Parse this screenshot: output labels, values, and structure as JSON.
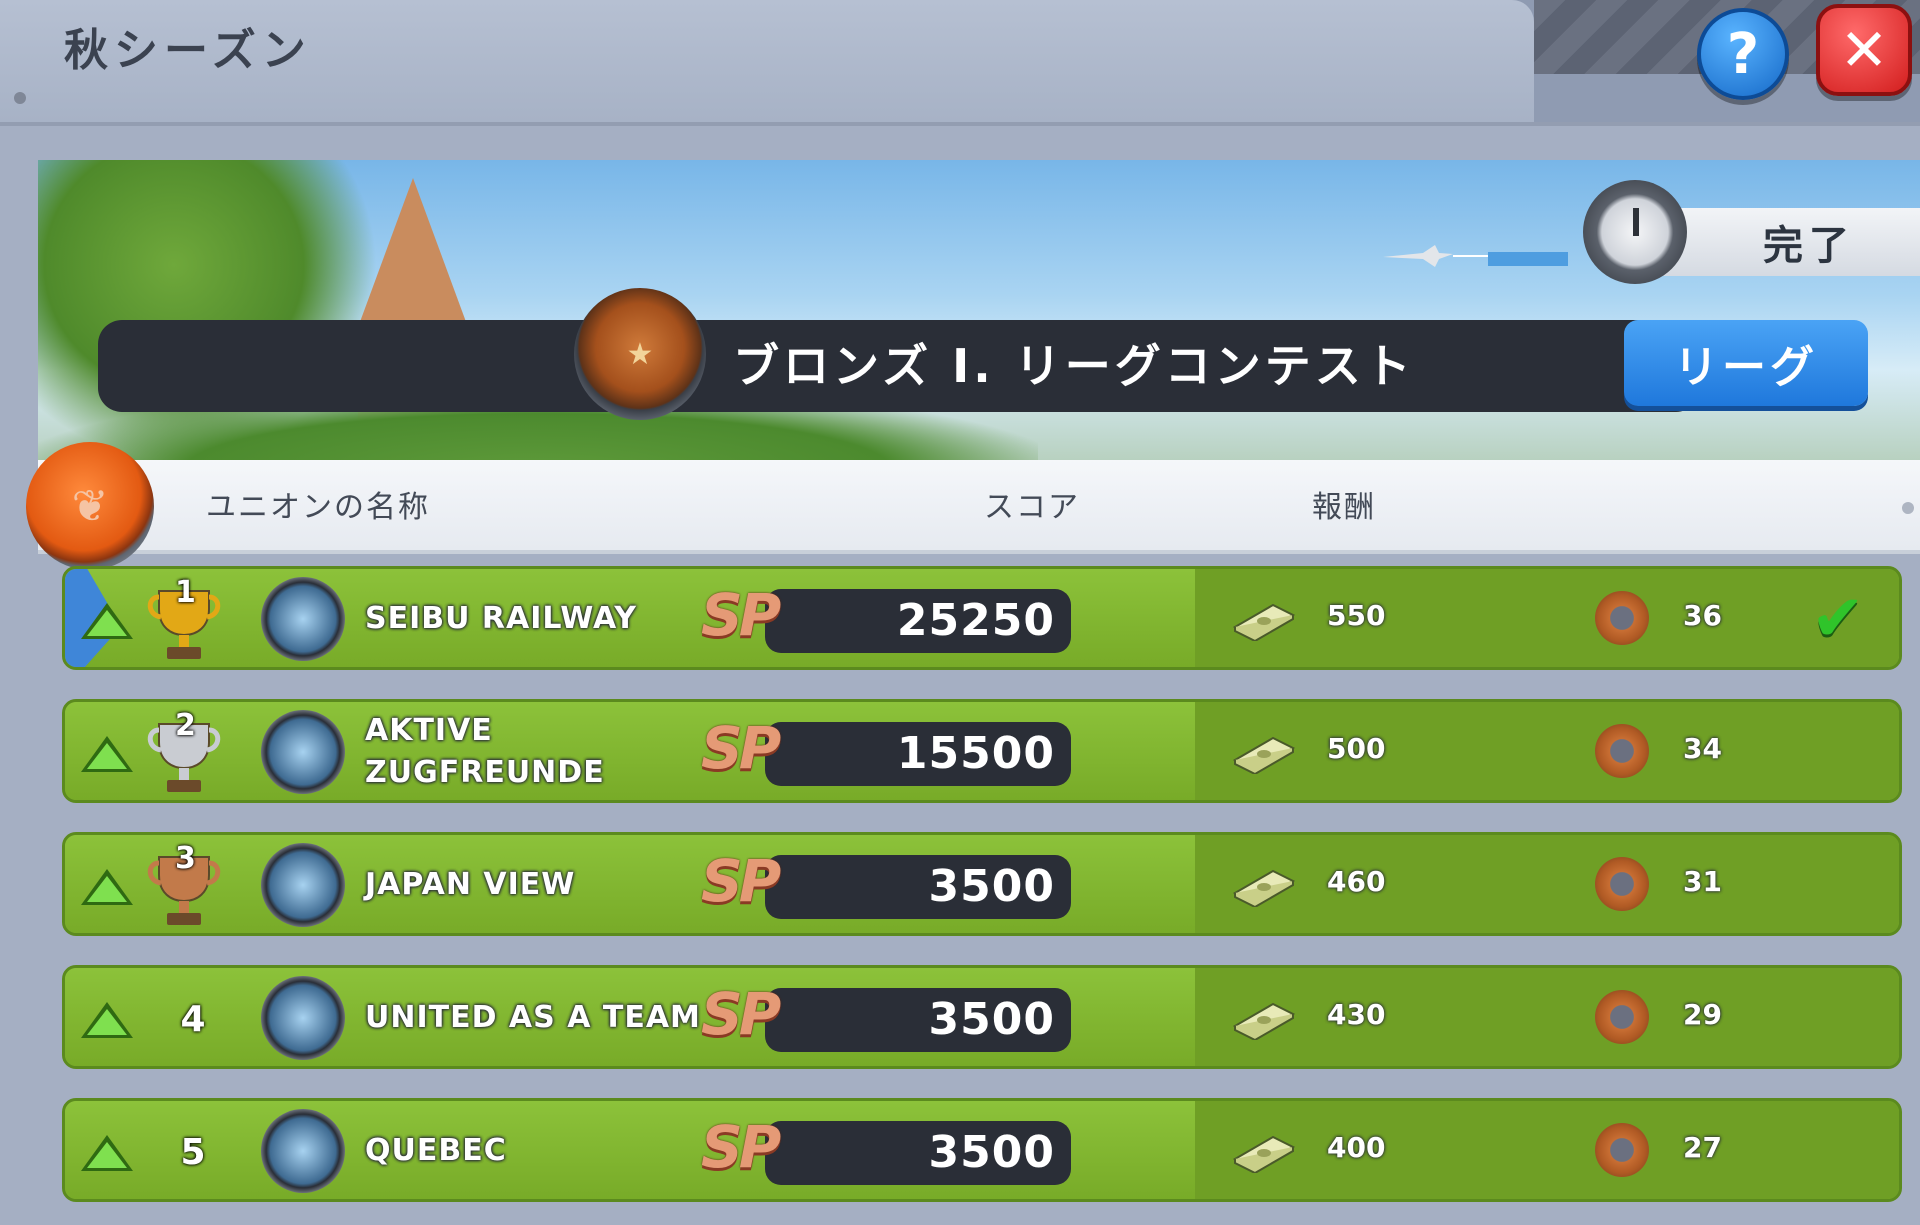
{
  "window": {
    "title": "秋シーズン"
  },
  "buttons": {
    "help": "?",
    "close": "✕"
  },
  "banner": {
    "timer_label": "完了",
    "contest_title": "ブロンズ I. リーグコンテスト",
    "league_button": "リーグ"
  },
  "table": {
    "headers": {
      "union_name": "ユニオンの名称",
      "score": "スコア",
      "reward": "報酬"
    },
    "score_unit": "SP",
    "rows": [
      {
        "rank": "1",
        "trophy": "gold-trophy",
        "name_line1": "SEIBU RAILWAY",
        "name_line2": "",
        "score": "25250",
        "cash": "550",
        "gears": "36",
        "completed": true
      },
      {
        "rank": "2",
        "trophy": "silver-trophy",
        "name_line1": "AKTIVE",
        "name_line2": "ZUGFREUNDE",
        "score": "15500",
        "cash": "500",
        "gears": "34",
        "completed": false
      },
      {
        "rank": "3",
        "trophy": "bronze-trophy",
        "name_line1": "JAPAN VIEW",
        "name_line2": "",
        "score": "3500",
        "cash": "460",
        "gears": "31",
        "completed": false
      },
      {
        "rank": "4",
        "trophy": "",
        "name_line1": "UNITED AS A TEAM",
        "name_line2": "",
        "score": "3500",
        "cash": "430",
        "gears": "29",
        "completed": false
      },
      {
        "rank": "5",
        "trophy": "",
        "name_line1": "QUEBEC",
        "name_line2": "",
        "score": "3500",
        "cash": "400",
        "gears": "27",
        "completed": false
      }
    ]
  },
  "colors": {
    "row_green": "#7fb32e",
    "league_blue": "#1f78dc",
    "title_bar": "#2a2e37",
    "sp_orange": "#e59a76"
  }
}
